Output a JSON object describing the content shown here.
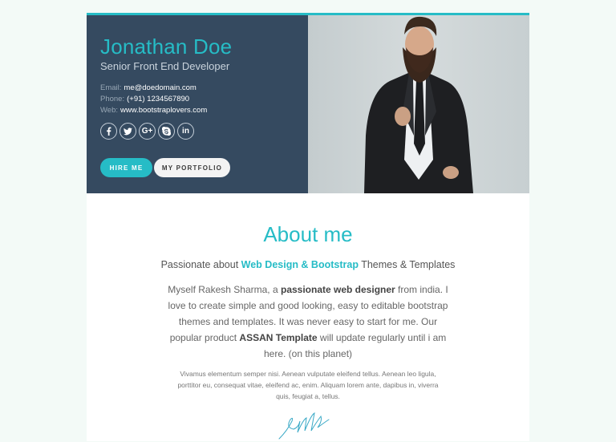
{
  "profile": {
    "name": "Jonathan Doe",
    "title": "Senior Front End Developer",
    "contact": {
      "email_label": "Email:",
      "email": "me@doedomain.com",
      "phone_label": "Phone:",
      "phone": "(+91) 1234567890",
      "web_label": "Web:",
      "web": "www.bootstraplovers.com"
    },
    "socials": [
      "facebook-icon",
      "twitter-icon",
      "google-plus-icon",
      "skype-icon",
      "linkedin-icon"
    ],
    "buttons": {
      "hire": "HIRE ME",
      "portfolio": "MY PORTFOLIO"
    }
  },
  "about": {
    "heading": "About me",
    "tagline_prefix": "Passionate about ",
    "tagline_highlight": "Web Design & Bootstrap",
    "tagline_suffix": " Themes & Templates",
    "bio_1": "Myself Rakesh Sharma, a ",
    "bio_2": "passionate web designer",
    "bio_3": " from india. I love to create simple and good looking, easy to editable bootstrap themes and templates. It was never easy to start for me. Our popular product ",
    "bio_4": "ASSAN Template",
    "bio_5": " will update regularly until i am here. (on this planet)",
    "small_text": "Vivamus elementum semper nisi. Aenean vulputate eleifend tellus. Aenean leo ligula, porttitor eu, consequat vitae, eleifend ac, enim. Aliquam lorem ante, dapibus in, viverra quis, feugiat a, tellus."
  },
  "colors": {
    "accent": "#26bcc6",
    "hero_bg": "#354a60",
    "page_bg": "#f3faf7"
  }
}
